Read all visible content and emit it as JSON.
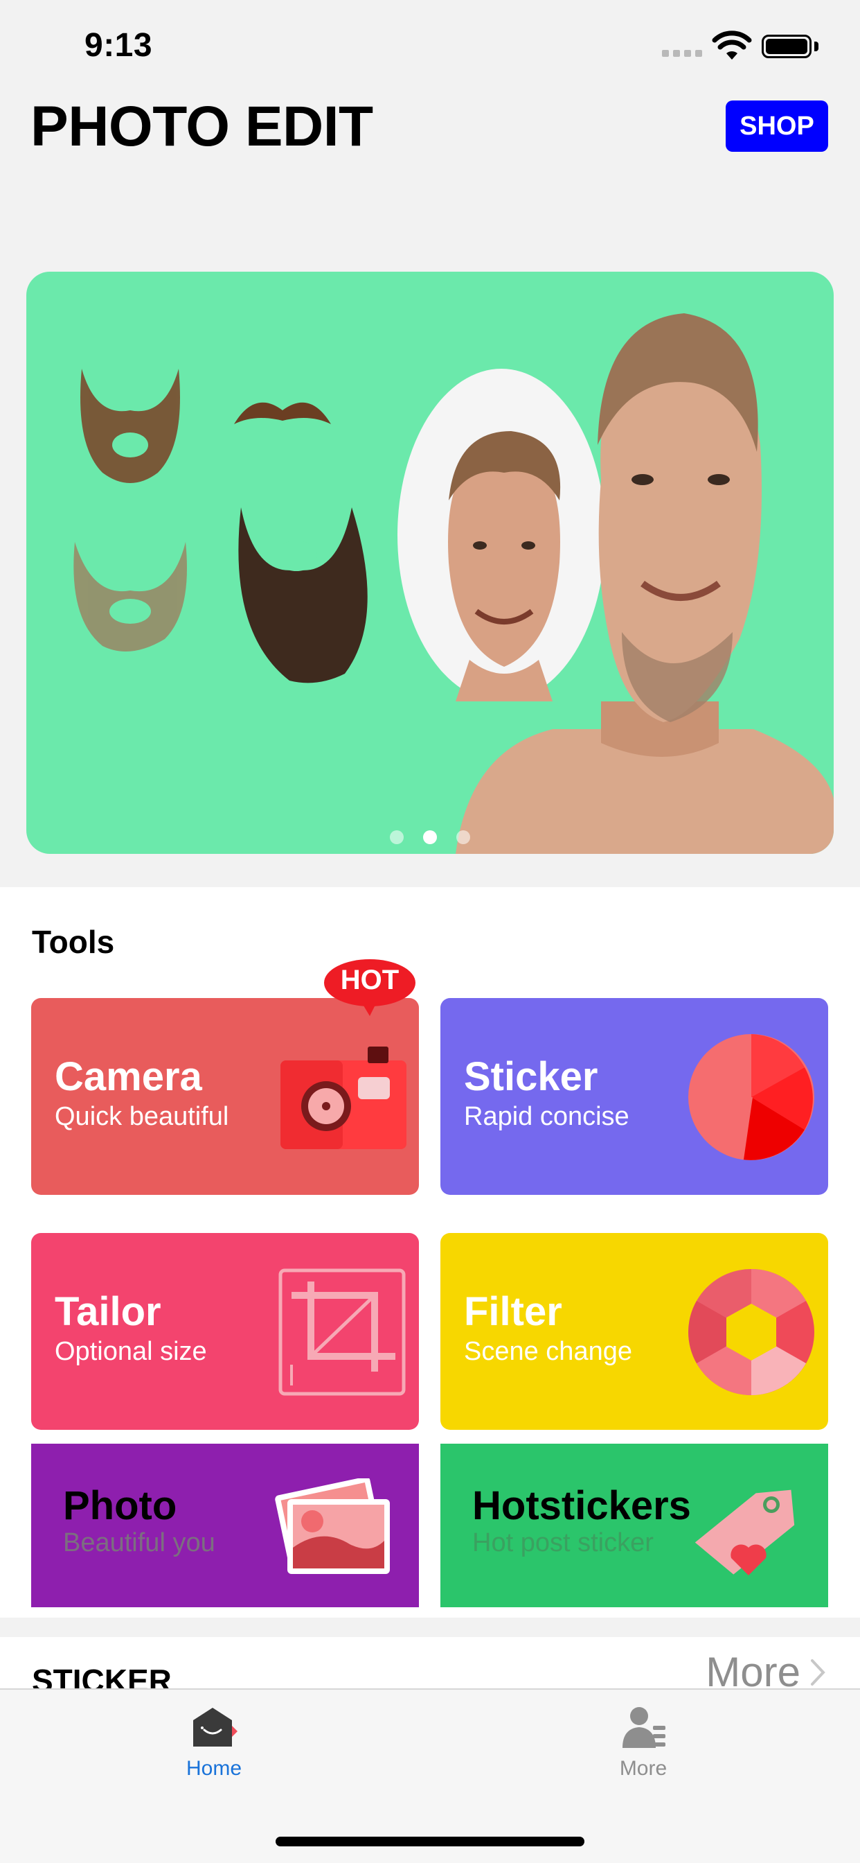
{
  "status_bar": {
    "time": "9:13"
  },
  "header": {
    "title": "PHOTO EDIT",
    "shop_label": "SHOP"
  },
  "banner": {
    "page_count": 3,
    "active_page": 2
  },
  "tools": {
    "title": "Tools",
    "hot_badge": "HOT",
    "items": [
      {
        "name": "Camera",
        "subtitle": "Quick beautiful",
        "color": "#e85c5c",
        "icon": "camera-icon"
      },
      {
        "name": "Sticker",
        "subtitle": "Rapid concise",
        "color": "#7569ee",
        "icon": "pie-chart-icon"
      },
      {
        "name": "Tailor",
        "subtitle": "Optional size",
        "color": "#f3446e",
        "icon": "crop-icon"
      },
      {
        "name": "Filter",
        "subtitle": "Scene change",
        "color": "#f7d700",
        "icon": "aperture-icon"
      },
      {
        "name": "Photo",
        "subtitle": "Beautiful you",
        "color": "#8e1fae",
        "icon": "photos-icon"
      },
      {
        "name": "Hotstickers",
        "subtitle": "Hot post sticker",
        "color": "#2bc56b",
        "icon": "price-tag-icon"
      }
    ]
  },
  "sticker_section": {
    "title": "STICKER",
    "more_label": "More"
  },
  "tab_bar": {
    "tabs": [
      {
        "label": "Home",
        "icon": "home-icon",
        "active": true
      },
      {
        "label": "More",
        "icon": "profile-list-icon",
        "active": false
      }
    ]
  }
}
